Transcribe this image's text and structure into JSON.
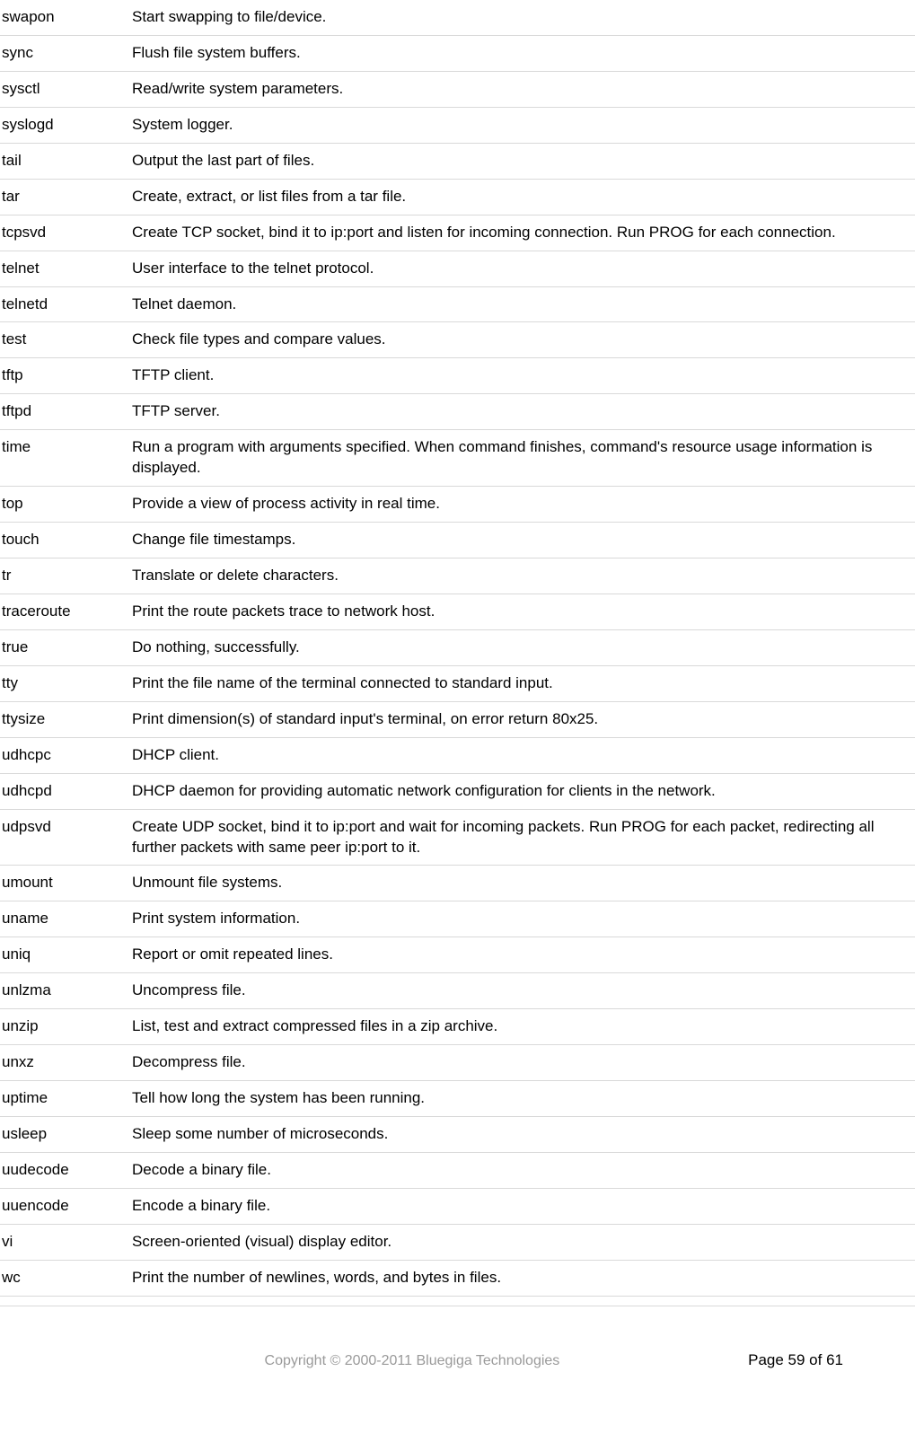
{
  "rows": [
    {
      "cmd": "swapon",
      "desc": "Start swapping to file/device."
    },
    {
      "cmd": "sync",
      "desc": "Flush file system buffers."
    },
    {
      "cmd": "sysctl",
      "desc": "Read/write system parameters."
    },
    {
      "cmd": "syslogd",
      "desc": "System logger."
    },
    {
      "cmd": "tail",
      "desc": "Output the last part of files."
    },
    {
      "cmd": "tar",
      "desc": "Create, extract, or list files from a tar file."
    },
    {
      "cmd": "tcpsvd",
      "desc": "Create TCP socket, bind it to ip:port and listen for incoming connection. Run PROG for each connection."
    },
    {
      "cmd": "telnet",
      "desc": "User interface to the telnet protocol."
    },
    {
      "cmd": "telnetd",
      "desc": "Telnet daemon."
    },
    {
      "cmd": "test",
      "desc": "Check file types and compare values."
    },
    {
      "cmd": "tftp",
      "desc": "TFTP client."
    },
    {
      "cmd": "tftpd",
      "desc": "TFTP server."
    },
    {
      "cmd": "time",
      "desc": "Run a program with arguments specified. When command finishes, command's resource usage information is displayed."
    },
    {
      "cmd": "top",
      "desc": "Provide a view of process activity in real time."
    },
    {
      "cmd": "touch",
      "desc": "Change file timestamps."
    },
    {
      "cmd": "tr",
      "desc": "Translate or delete characters."
    },
    {
      "cmd": "traceroute",
      "desc": "Print the route packets trace to network host."
    },
    {
      "cmd": "true",
      "desc": "Do nothing, successfully."
    },
    {
      "cmd": "tty",
      "desc": "Print the file name of the terminal connected to standard input."
    },
    {
      "cmd": "ttysize",
      "desc": "Print dimension(s) of standard input's terminal, on error return 80x25."
    },
    {
      "cmd": "udhcpc",
      "desc": "DHCP client."
    },
    {
      "cmd": "udhcpd",
      "desc": "DHCP daemon for providing automatic network configuration for clients in the network."
    },
    {
      "cmd": "udpsvd",
      "desc": "Create UDP socket, bind it to ip:port and wait for incoming packets. Run PROG for each packet, redirecting all further packets with same peer ip:port to it."
    },
    {
      "cmd": "umount",
      "desc": "Unmount file systems."
    },
    {
      "cmd": "uname",
      "desc": "Print system information."
    },
    {
      "cmd": "uniq",
      "desc": "Report or omit repeated lines."
    },
    {
      "cmd": "unlzma",
      "desc": "Uncompress file."
    },
    {
      "cmd": "unzip",
      "desc": "List, test and extract compressed files in a zip archive."
    },
    {
      "cmd": "unxz",
      "desc": "Decompress file."
    },
    {
      "cmd": "uptime",
      "desc": "Tell how long the system has been running."
    },
    {
      "cmd": "usleep",
      "desc": "Sleep some number of microseconds."
    },
    {
      "cmd": "uudecode",
      "desc": "Decode a binary file."
    },
    {
      "cmd": "uuencode",
      "desc": "Encode a binary file."
    },
    {
      "cmd": "vi",
      "desc": "Screen-oriented (visual) display editor."
    },
    {
      "cmd": "wc",
      "desc": "Print the number of newlines, words, and bytes in files."
    }
  ],
  "footer": {
    "copyright": "Copyright © 2000-2011 Bluegiga Technologies",
    "page_label": "Page 59 of 61"
  }
}
